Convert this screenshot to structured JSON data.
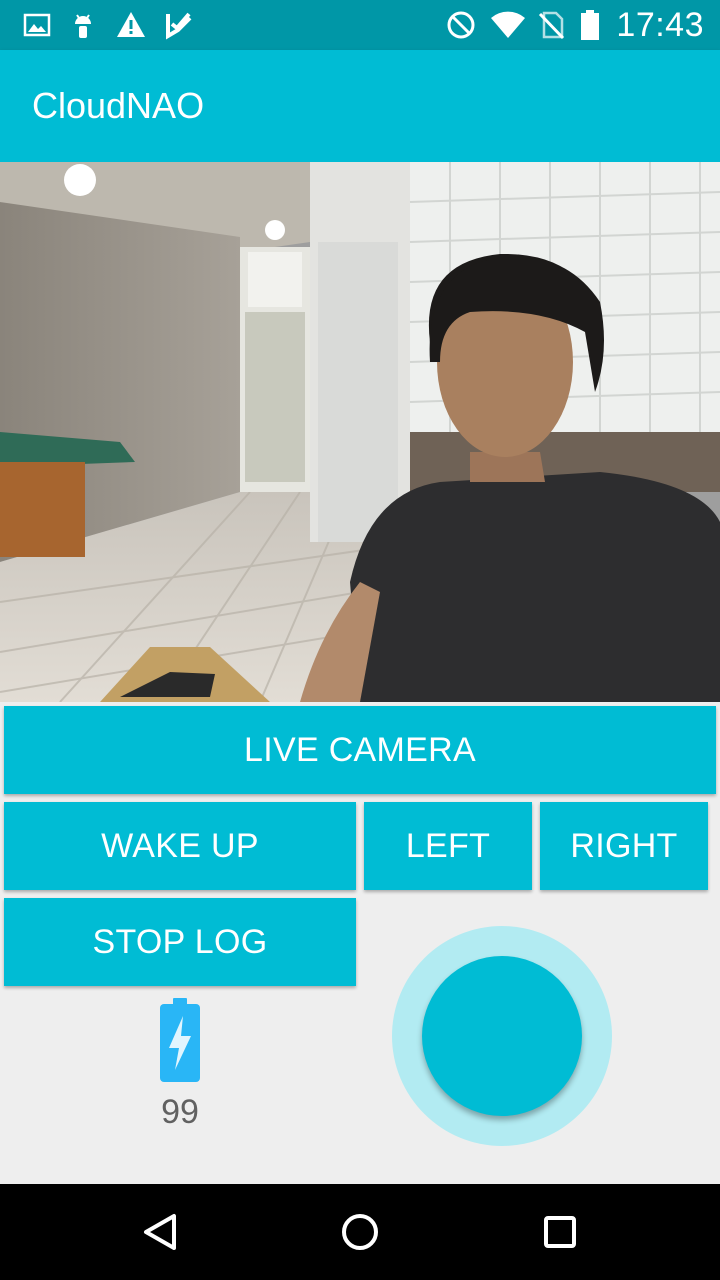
{
  "status_bar": {
    "time": "17:43",
    "left_icons": [
      "image-notification-icon",
      "android-debug-icon",
      "warning-icon",
      "task-check-icon"
    ],
    "right_icons": [
      "do-not-disturb-icon",
      "wifi-icon",
      "no-sim-icon",
      "battery-full-icon"
    ]
  },
  "app_bar": {
    "title": "CloudNAO"
  },
  "camera": {
    "description_icon": "camera-feed"
  },
  "buttons": {
    "live_camera": "LIVE CAMERA",
    "wake_up": "WAKE UP",
    "left": "LEFT",
    "right": "RIGHT",
    "stop_log": "STOP LOG"
  },
  "battery": {
    "level": "99",
    "icon": "battery-charging-icon"
  },
  "colors": {
    "primary": "#00bcd4",
    "primary_dark": "#0097a7",
    "joystick_ring": "#b2ebf2",
    "background": "#eeeeee"
  },
  "nav_bar": {
    "icons": [
      "back-icon",
      "home-icon",
      "recents-icon"
    ]
  }
}
